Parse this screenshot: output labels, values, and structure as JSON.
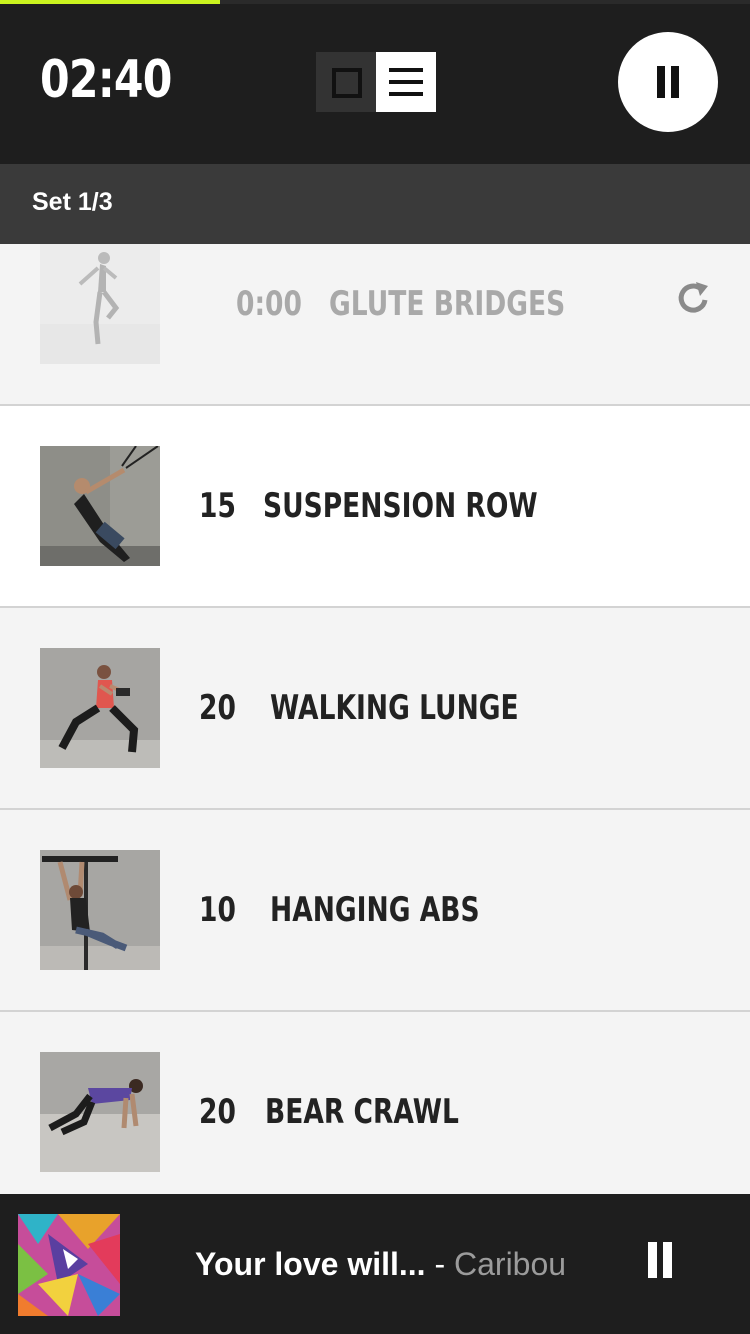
{
  "workout": {
    "timer": "02:40",
    "progress": 0.293,
    "set_label": "Set 1/3"
  },
  "header": {
    "view_single_icon": "square-icon",
    "view_list_icon": "list-icon",
    "pause_icon": "pause-icon"
  },
  "exercises": [
    {
      "count": "0:00",
      "name": "GLUTE BRIDGES",
      "state": "completed",
      "action_icon": "replay-icon"
    },
    {
      "count": "15",
      "name": "SUSPENSION ROW",
      "state": "current"
    },
    {
      "count": "20",
      "name": "WALKING LUNGE",
      "state": "upcoming"
    },
    {
      "count": "10",
      "name": "HANGING ABS",
      "state": "upcoming"
    },
    {
      "count": "20",
      "name": "BEAR CRAWL",
      "state": "upcoming"
    }
  ],
  "music": {
    "title": "Your love will...",
    "separator": "-",
    "artist": "Caribou",
    "pause_icon": "pause-icon"
  },
  "colors": {
    "accent": "#cbf31f",
    "header_bg": "#1e1e1e",
    "setbar_bg": "#3a3a3a",
    "row_bg": "#f4f4f4"
  }
}
